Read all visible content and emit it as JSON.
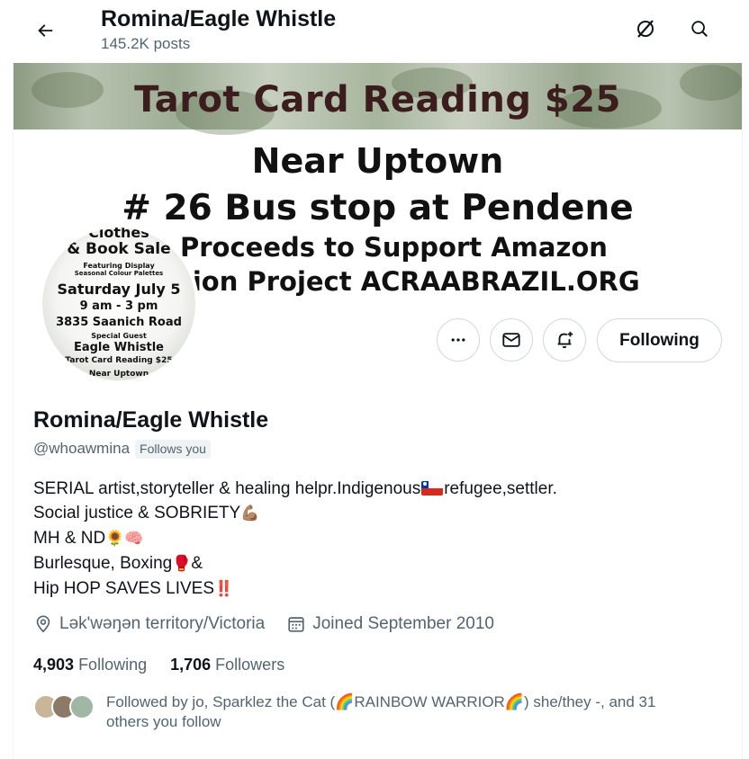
{
  "header": {
    "title": "Romina/Eagle Whistle",
    "posts": "145.2K posts",
    "back_icon": "arrow-left-icon",
    "grok_icon": "grok-icon",
    "search_icon": "search-icon"
  },
  "banner": {
    "line1": "Tarot Card Reading $25",
    "line2": "Near Uptown",
    "line3": "# 26 Bus stop at Pendene",
    "line4": "Proceeds to Support Amazon",
    "line5": "tion Project ACRAABRAZIL.ORG"
  },
  "avatar": {
    "l1": "Clothes",
    "l2": "& Book Sale",
    "l3": "Featuring Display",
    "l4": "Seasonal Colour Palettes",
    "l5": "Saturday July 5",
    "l6": "9 am - 3 pm",
    "l7": "3835 Saanich Road",
    "l8": "Special Guest",
    "l9": "Eagle Whistle",
    "l10": "Tarot Card Reading $25",
    "l11": "Near Uptown"
  },
  "actions": {
    "more_icon": "more-icon",
    "message_icon": "envelope-icon",
    "notify_icon": "bell-plus-icon",
    "following_label": "Following"
  },
  "profile": {
    "name": "Romina/Eagle Whistle",
    "handle": "@whoawmina",
    "follows_you": "Follows you",
    "bio": {
      "line1a": "SERIAL artist,storyteller & healing helpr.Indigenous",
      "line1b": "refugee,settler.",
      "line2": "Social justice & SOBRIETY",
      "line2_emoji": "💪🏽",
      "line3": "MH & ND",
      "line3_emoji": "🌻🧠",
      "line4": "Burlesque, Boxing",
      "line4_emoji": "🥊",
      "line4_end": "&",
      "line5": "Hip HOP SAVES LIVES",
      "line5_emoji": "‼️"
    },
    "location": "Lək'wəŋən territory/Victoria",
    "joined": "Joined September 2010",
    "location_icon": "location-pin-icon",
    "calendar_icon": "calendar-icon"
  },
  "stats": {
    "following_count": "4,903",
    "following_label": "Following",
    "followers_count": "1,706",
    "followers_label": "Followers"
  },
  "followed_by": {
    "text": "Followed by jo, Sparklez the Cat (🌈RAINBOW WARRIOR🌈) she/they -, and 31 others you follow"
  }
}
